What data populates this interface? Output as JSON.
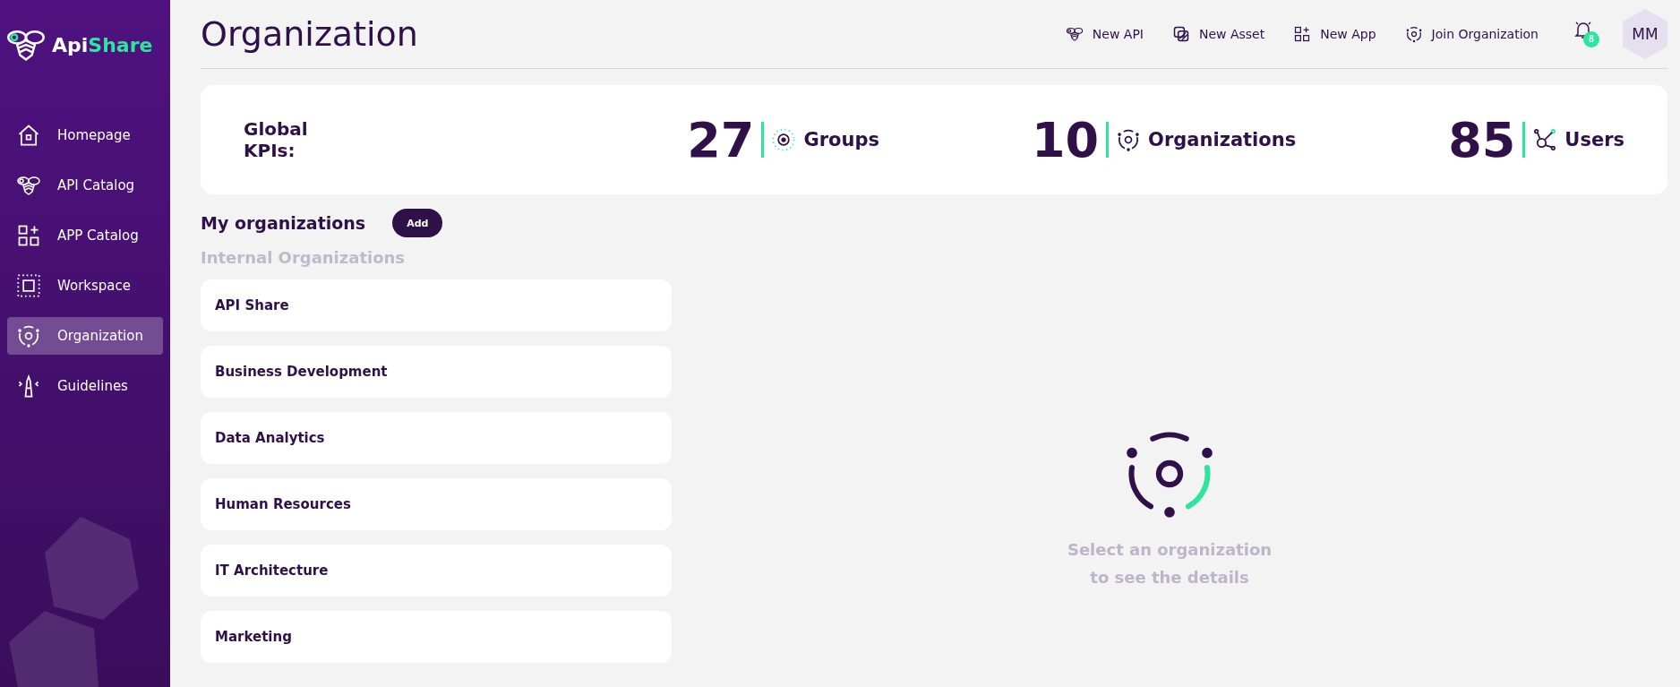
{
  "brand": {
    "part1": "Api",
    "part2": "Share"
  },
  "sidebar": {
    "items": [
      {
        "label": "Homepage",
        "selected": false
      },
      {
        "label": "API Catalog",
        "selected": false
      },
      {
        "label": "APP Catalog",
        "selected": false
      },
      {
        "label": "Workspace",
        "selected": false
      },
      {
        "label": "Organization",
        "selected": true
      },
      {
        "label": "Guidelines",
        "selected": false
      }
    ]
  },
  "header": {
    "title": "Organization",
    "actions": [
      "New API",
      "New Asset",
      "New App",
      "Join Organization"
    ],
    "notifications": "8",
    "avatar": "MM"
  },
  "kpis": {
    "label": "Global KPIs:",
    "items": [
      {
        "value": "27",
        "label": "Groups"
      },
      {
        "value": "10",
        "label": "Organizations"
      },
      {
        "value": "85",
        "label": "Users"
      }
    ]
  },
  "organizations": {
    "title": "My organizations",
    "add_button": "Add",
    "section": "Internal Organizations",
    "items": [
      "API Share",
      "Business Development",
      "Data Analytics",
      "Human Resources",
      "IT Architecture",
      "Marketing"
    ]
  },
  "empty_state": {
    "line1": "Select an organization",
    "line2": "to see the details"
  }
}
